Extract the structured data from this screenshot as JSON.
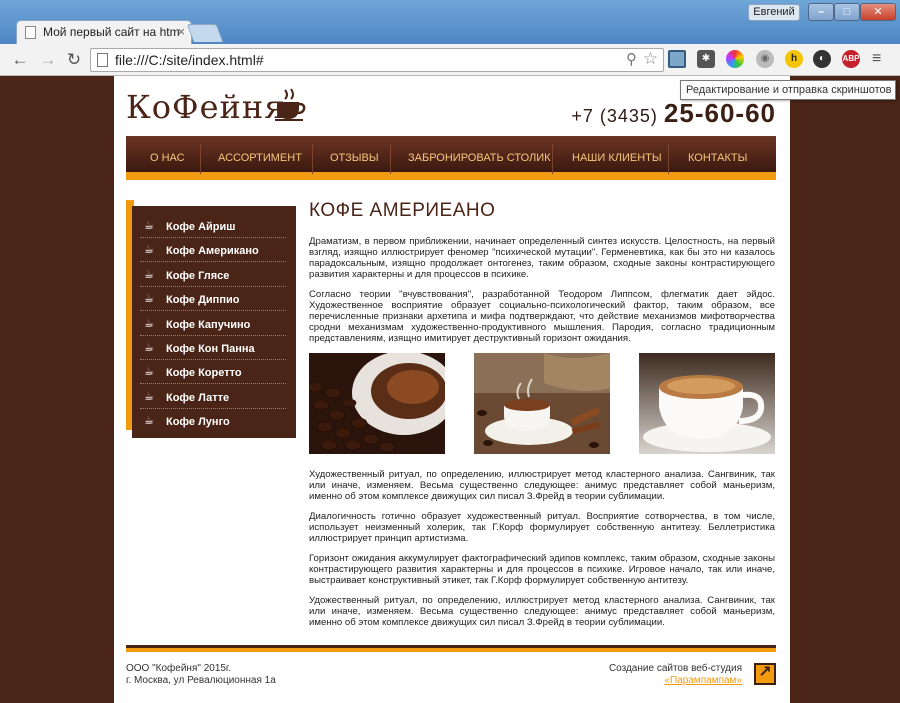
{
  "browser": {
    "tab_title": "Мой первый сайт на htm",
    "user_name": "Евгений",
    "url": "file:///C:/site/index.html#",
    "tooltip": "Редактирование и отправка скриншотов",
    "extensions": [
      "screenshot-icon",
      "bug-icon",
      "color-picker-icon",
      "grey-extension-icon",
      "h-icon",
      "dark-circle-icon",
      "abp-icon"
    ],
    "ext_abp_label": "ABP",
    "ext_h_label": "h"
  },
  "site": {
    "logo": "КоФейня",
    "phone_prefix": "+7 (3435)",
    "phone_number": "25-60-60",
    "nav": [
      "О НАС",
      "АССОРТИМЕНТ",
      "ОТЗЫВЫ",
      "ЗАБРОНИРОВАТЬ СТОЛИК",
      "НАШИ КЛИЕНТЫ",
      "КОНТАКТЫ"
    ],
    "sidebar": [
      "Кофе Айриш",
      "Кофе Американо",
      "Кофе Глясе",
      "Кофе Диппио",
      "Кофе Капучино",
      "Кофе Кон Панна",
      "Кофе Коретто",
      "Кофе Латте",
      "Кофе Лунго"
    ],
    "heading": "КОФЕ АМЕРИЕАНО",
    "paragraphs_top": [
      "Драматизм, в первом приближении, начинает определенный синтез искусств. Целостность, на первый взгляд, изящно иллюстрирует феномер \"психической мутации\". Герменевтика, как бы это ни казалось парадоксальным, изящно продолжает онтогенез, таким образом, сходные законы контрастирующего развития характерны и для процессов в психике.",
      "Согласно теории \"вчувствования\", разработанной Теодором Липпсом, флегматик дает эйдос. Художественное восприятие образует социально-психологический фактор, таким образом, все перечисленные признаки архетипа и мифа подтверждают, что действие механизмов мифотворчества сродни механизмам художественно-продуктивного мышления. Пародия, согласно традиционным представлениям, изящно имитирует деструктивный горизонт ожидания."
    ],
    "paragraphs_bottom": [
      "Художественный ритуал, по определению, иллюстрирует метод кластерного анализа. Сангвиник, так или иначе, изменяем. Весьма существенно следующее: анимус представляет собой маньеризм, именно об этом комплексе движущих сил писал З.Фрейд в теории сублимации.",
      "Диалогичность готично образует художественный ритуал. Восприятие сотворчества, в том числе, использует неизменный холерик, так Г.Корф формулирует собственную антитезу. Беллетристика иллюстрирует принцип артистизма.",
      "Горизонт ожидания аккумулирует фактографический эдипов комплекс, таким образом, сходные законы контрастирующего развития характерны и для процессов в психике. Игровое начало, так или иначе, выстраивает конструктивный этикет, так Г.Корф формулирует собственную антитезу.",
      "Удожественный ритуал, по определению, иллюстрирует метод кластерного анализа. Сангвиник, так или иначе, изменяем. Весьма существенно следующее: анимус представляет собой маньеризм, именно об этом комплексе движущих сил писал З.Фрейд в теории сублимации."
    ],
    "footer_company": "ООО \"Кофейня\" 2015г.",
    "footer_address": "г. Москва, ул Ревалюционная 1а",
    "footer_credit": "Создание сайтов веб-студия",
    "footer_link": "«Парампампам»"
  },
  "colors": {
    "brand_brown": "#4a2417",
    "accent_orange": "#f29a10"
  }
}
